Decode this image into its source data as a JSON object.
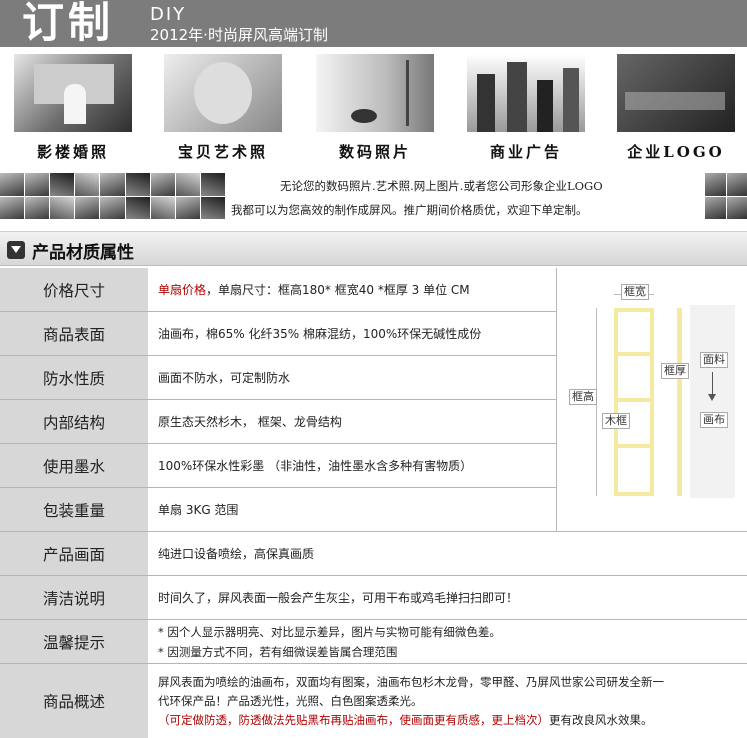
{
  "banner": {
    "big_title": "订制",
    "diy": "DIY",
    "subtitle": "2012年·时尚屏风高端订制"
  },
  "categories": [
    {
      "label": "影楼婚照"
    },
    {
      "label": "宝贝艺术照"
    },
    {
      "label": "数码照片"
    },
    {
      "label": "商业广告"
    },
    {
      "label": "企业LOGO"
    }
  ],
  "marketing": {
    "line1": "无论您的数码照片.艺术照.网上图片.或者您公司形象企业LOGO",
    "line2": "我都可以为您高效的制作成屏风。推广期间价格质优，欢迎下单定制。"
  },
  "section": {
    "title": "产品材质属性"
  },
  "rows": [
    {
      "label": "价格尺寸",
      "value_red": "单扇价格",
      "value": "，单扇尺寸：框高180* 框宽40 *框厚   3    单位 CM"
    },
    {
      "label": "商品表面",
      "value": "油画布，棉65% 化纤35% 棉麻混纺，100%环保无碱性成份"
    },
    {
      "label": "防水性质",
      "value": "画面不防水，可定制防水"
    },
    {
      "label": "内部结构",
      "value": "原生态天然杉木， 框架、龙骨结构"
    },
    {
      "label": "使用墨水",
      "value": "100%环保水性彩墨 （非油性，油性墨水含多种有害物质）"
    },
    {
      "label": "包装重量",
      "value": "单扇 3KG  范围"
    },
    {
      "label": "产品画面",
      "value": "纯进口设备喷绘，高保真画质"
    },
    {
      "label": "清洁说明",
      "value": "时间久了，屏风表面一般会产生灰尘，可用干布或鸡毛掸扫扫即可！"
    },
    {
      "label": "温馨提示",
      "notes": [
        "* 因个人显示器明亮、对比显示差异，图片与实物可能有细微色差。",
        "* 因测量方式不同，若有细微误差皆属合理范围"
      ]
    },
    {
      "label": "商品概述",
      "overview_1": "屏风表面为喷绘的油画布，双面均有图案，油画布包杉木龙骨，零甲醛、乃屏风世家公司研发全新一",
      "overview_2": "代环保产品！产品透光性，光照、白色图案透柔光。",
      "overview_red": "（可定做防透，防透做法先贴黑布再贴油画布，使画面更有质感，更上档次）",
      "overview_end": "更有改良风水效果。"
    }
  ],
  "diagram": {
    "frame_width": "框宽",
    "frame_height": "框高",
    "frame_thickness": "框厚",
    "wood_frame": "木框",
    "fabric": "面料",
    "canvas": "画布"
  }
}
